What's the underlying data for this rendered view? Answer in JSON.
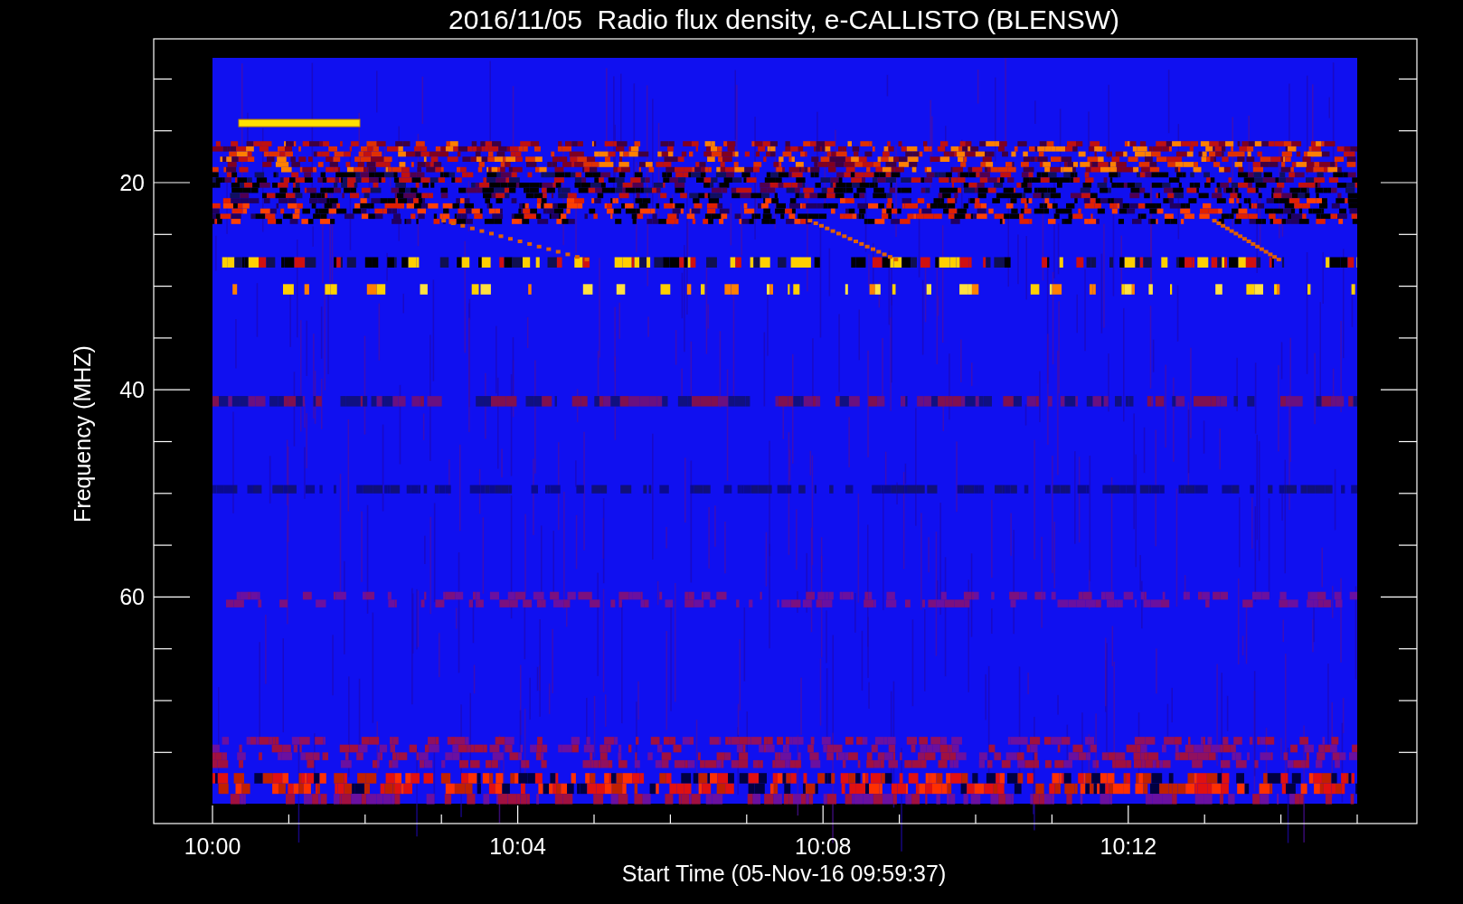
{
  "title": "2016/11/05  Radio flux density, e-CALLISTO (BLENSW)",
  "plot": {
    "ylabel": "Frequency (MHZ)",
    "xlabel": "Start Time (05-Nov-16 09:59:37)",
    "yticks": [
      "20",
      "40",
      "60"
    ],
    "xticks": [
      "10:00",
      "10:04",
      "10:08",
      "10:12"
    ]
  }
}
